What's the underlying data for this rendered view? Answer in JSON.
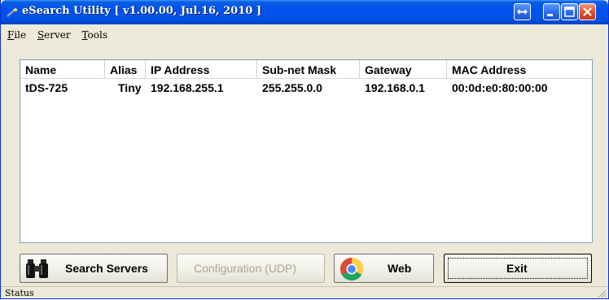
{
  "window": {
    "title": "eSearch Utility [ v1.00.00, Jul.16, 2010 ]"
  },
  "menu": [
    {
      "label": "File",
      "hotkey": "F",
      "rest": "ile"
    },
    {
      "label": "Server",
      "hotkey": "S",
      "rest": "erver"
    },
    {
      "label": "Tools",
      "hotkey": "T",
      "rest": "ools"
    }
  ],
  "table": {
    "columns": [
      "Name",
      "Alias",
      "IP Address",
      "Sub-net Mask",
      "Gateway",
      "MAC Address"
    ],
    "rows": [
      [
        "tDS-725",
        "Tiny",
        "192.168.255.1",
        "255.255.0.0",
        "192.168.0.1",
        "00:0d:e0:80:00:00"
      ]
    ]
  },
  "buttons": {
    "search": "Search Servers",
    "configuration": "Configuration (UDP)",
    "web": "Web",
    "exit": "Exit"
  },
  "status": {
    "text": "Status"
  },
  "icons": {
    "app": "wand-icon",
    "search": "binoculars-icon",
    "web": "chrome-browser-icon",
    "title_buttons": [
      "restore-arrows-icon",
      "minimize-icon",
      "maximize-icon",
      "close-icon"
    ]
  }
}
